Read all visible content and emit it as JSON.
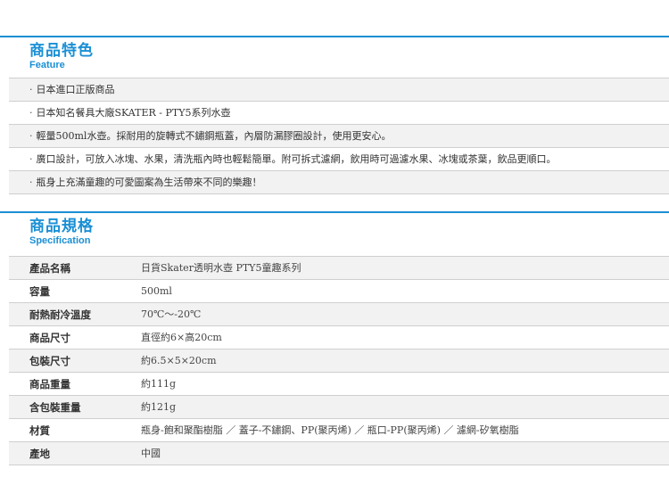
{
  "feature": {
    "title": "商品特色",
    "subtitle": "Feature",
    "items": [
      "日本進口正版商品",
      "日本知名餐具大廠SKATER - PTY5系列水壺",
      "輕量500ml水壺。採耐用的旋轉式不鏽鋼瓶蓋，內層防漏膠圈設計，使用更安心。",
      "廣口設計，可放入冰塊、水果，清洗瓶內時也輕鬆簡單。附可拆式濾網，飲用時可過濾水果、冰塊或茶葉，飲品更順口。",
      "瓶身上充滿童趣的可愛圖案為生活帶來不同的樂趣！"
    ]
  },
  "specification": {
    "title": "商品規格",
    "subtitle": "Specification",
    "rows": [
      {
        "label": "產品名稱",
        "value": "日貨Skater透明水壺 PTY5童趣系列"
      },
      {
        "label": "容量",
        "value": "500ml"
      },
      {
        "label": "耐熱耐冷溫度",
        "value": "70℃～-20℃"
      },
      {
        "label": "商品尺寸",
        "value": "直徑約6×高20cm"
      },
      {
        "label": "包裝尺寸",
        "value": "約6.5×5×20cm"
      },
      {
        "label": "商品重量",
        "value": "約111g"
      },
      {
        "label": "含包裝重量",
        "value": "約121g"
      },
      {
        "label": "材質",
        "value": "瓶身-飽和聚酯樹脂 ／ 蓋子-不鏽鋼、PP(聚丙烯) ／ 瓶口-PP(聚丙烯) ／ 濾網-矽氧樹脂"
      },
      {
        "label": "產地",
        "value": "中國"
      }
    ]
  },
  "colors": {
    "accent": "#1a8fd4",
    "row_shade": "#f2f2f2",
    "divider": "#cfcfcf"
  }
}
